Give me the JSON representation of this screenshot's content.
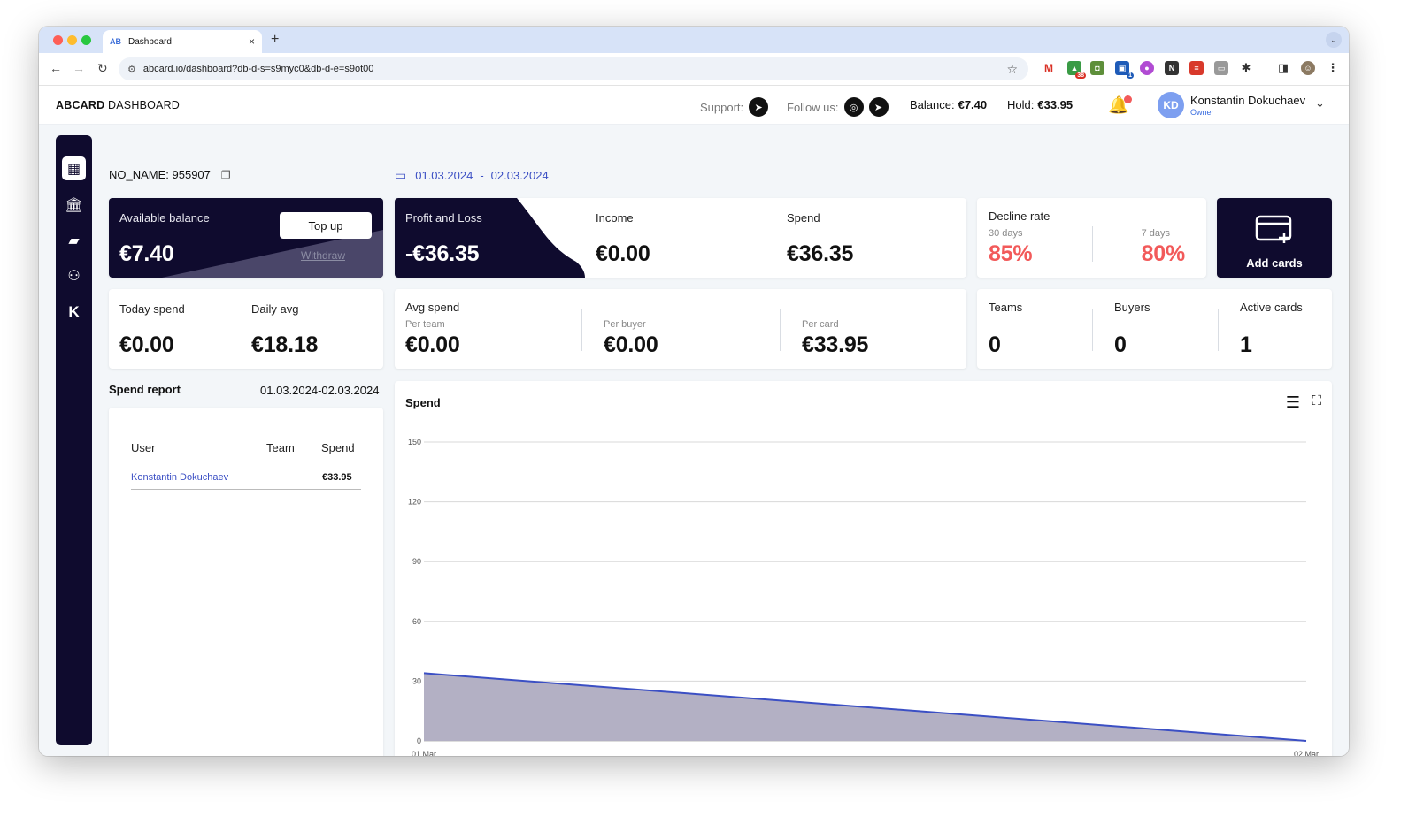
{
  "browser": {
    "tab_title": "Dashboard",
    "url": "abcard.io/dashboard?db-d-s=s9myc0&db-d-e=s9ot00",
    "ext_badge_1": "38",
    "ext_badge_2": "1"
  },
  "header": {
    "logo_bold": "ABCARD",
    "logo_rest": " DASHBOARD",
    "support_label": "Support:",
    "follow_label": "Follow us:",
    "balance_label": "Balance:",
    "balance_value": "€7.40",
    "hold_label": "Hold:",
    "hold_value": "€33.95",
    "avatar_initials": "KD",
    "user_name": "Konstantin Dokuchaev",
    "user_role": "Owner"
  },
  "account": {
    "name": "NO_NAME: 955907",
    "date_from": "01.03.2024",
    "date_sep": "-",
    "date_to": "02.03.2024"
  },
  "balance_card": {
    "label": "Available balance",
    "value": "€7.40",
    "topup": "Top up",
    "withdraw": "Withdraw"
  },
  "pnl_card": {
    "pnl_label": "Profit and Loss",
    "pnl_value": "-€36.35",
    "income_label": "Income",
    "income_value": "€0.00",
    "spend_label": "Spend",
    "spend_value": "€36.35"
  },
  "decline_card": {
    "label": "Decline rate",
    "d30_label": "30 days",
    "d30_value": "85%",
    "d7_label": "7 days",
    "d7_value": "80%",
    "accent": "#f25a5a"
  },
  "add_cards": {
    "label": "Add cards"
  },
  "today_card": {
    "today_label": "Today spend",
    "today_value": "€0.00",
    "avg_label": "Daily avg",
    "avg_value": "€18.18"
  },
  "avg_spend_card": {
    "label": "Avg spend",
    "team_label": "Per team",
    "team_value": "€0.00",
    "buyer_label": "Per buyer",
    "buyer_value": "€0.00",
    "card_label": "Per card",
    "card_value": "€33.95"
  },
  "counts_card": {
    "teams_label": "Teams",
    "teams_value": "0",
    "buyers_label": "Buyers",
    "buyers_value": "0",
    "active_label": "Active cards",
    "active_value": "1"
  },
  "spend_report": {
    "title": "Spend report",
    "range": "01.03.2024-02.03.2024",
    "columns": [
      "User",
      "Team",
      "Spend"
    ],
    "rows": [
      {
        "user": "Konstantin Dokuchaev",
        "team": "",
        "spend": "€33.95"
      }
    ]
  },
  "chart_data": {
    "type": "area",
    "title": "Spend",
    "x": [
      "01 Mar",
      "02 Mar"
    ],
    "series": [
      {
        "values": [
          34,
          0
        ]
      }
    ],
    "ylim": [
      0,
      150
    ],
    "yticks": [
      0,
      30,
      60,
      90,
      120,
      150
    ],
    "grid": true,
    "line_color": "#3b4fc4",
    "fill_color": "#b3b0c4"
  }
}
